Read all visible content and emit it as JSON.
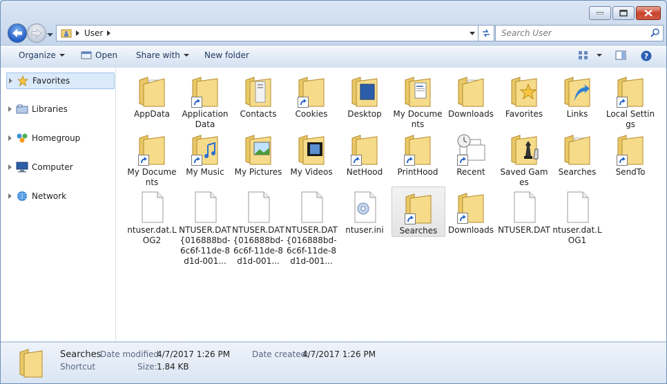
{
  "window": {
    "address": {
      "crumbs": [
        "User"
      ]
    },
    "search": {
      "placeholder": "Search User"
    }
  },
  "toolbar": {
    "organize": "Organize",
    "open": "Open",
    "share_with": "Share with",
    "new_folder": "New folder"
  },
  "nav": {
    "items": [
      {
        "label": "Favorites",
        "icon": "star-icon",
        "selected": true
      },
      {
        "label": "Libraries",
        "icon": "libraries-icon"
      },
      {
        "label": "Homegroup",
        "icon": "homegroup-icon"
      },
      {
        "label": "Computer",
        "icon": "computer-icon"
      },
      {
        "label": "Network",
        "icon": "network-icon"
      }
    ]
  },
  "items": [
    {
      "label": "AppData",
      "type": "folder",
      "overlay": "papers"
    },
    {
      "label": "Application Data",
      "type": "folder-shortcut"
    },
    {
      "label": "Contacts",
      "type": "folder",
      "overlay": "contacts"
    },
    {
      "label": "Cookies",
      "type": "folder-shortcut"
    },
    {
      "label": "Desktop",
      "type": "folder",
      "overlay": "desktop"
    },
    {
      "label": "My Documents",
      "type": "folder",
      "overlay": "doc"
    },
    {
      "label": "Downloads",
      "type": "folder",
      "overlay": "papers"
    },
    {
      "label": "Favorites",
      "type": "folder",
      "overlay": "star"
    },
    {
      "label": "Links",
      "type": "folder",
      "overlay": "arrow"
    },
    {
      "label": "Local Settings",
      "type": "folder-shortcut"
    },
    {
      "label": "My Documents",
      "type": "folder-shortcut"
    },
    {
      "label": "My Music",
      "type": "folder-shortcut",
      "overlay": "music"
    },
    {
      "label": "My Pictures",
      "type": "folder",
      "overlay": "picture"
    },
    {
      "label": "My Videos",
      "type": "folder",
      "overlay": "video"
    },
    {
      "label": "NetHood",
      "type": "folder-shortcut"
    },
    {
      "label": "PrintHood",
      "type": "folder-shortcut"
    },
    {
      "label": "Recent",
      "type": "recent-shortcut"
    },
    {
      "label": "Saved Games",
      "type": "folder",
      "overlay": "chess"
    },
    {
      "label": "Searches",
      "type": "folder",
      "overlay": "papers"
    },
    {
      "label": "SendTo",
      "type": "folder-shortcut"
    },
    {
      "label": "ntuser.dat.LOG2",
      "type": "file"
    },
    {
      "label": "NTUSER.DAT{016888bd-6c6f-11de-8d1d-001...",
      "type": "file"
    },
    {
      "label": "NTUSER.DAT{016888bd-6c6f-11de-8d1d-001...",
      "type": "file"
    },
    {
      "label": "NTUSER.DAT{016888bd-6c6f-11de-8d1d-001...",
      "type": "file"
    },
    {
      "label": "ntuser.ini",
      "type": "ini"
    },
    {
      "label": "Searches",
      "type": "folder-shortcut",
      "selected": true
    },
    {
      "label": "Downloads",
      "type": "folder-shortcut"
    },
    {
      "label": "NTUSER.DAT",
      "type": "file"
    },
    {
      "label": "ntuser.dat.LOG1",
      "type": "file"
    }
  ],
  "details": {
    "name": "Searches",
    "kind": "Shortcut",
    "modified_label": "Date modified:",
    "modified_value": "4/7/2017 1:26 PM",
    "size_label": "Size:",
    "size_value": "1.84 KB",
    "created_label": "Date created:",
    "created_value": "4/7/2017 1:26 PM"
  }
}
